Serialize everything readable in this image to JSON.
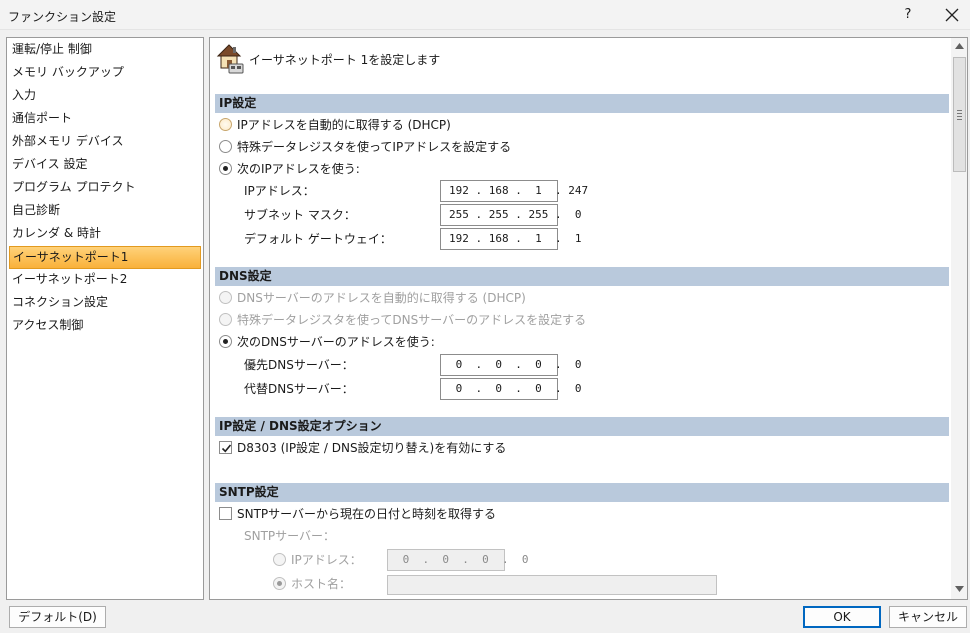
{
  "window": {
    "title": "ファンクション設定",
    "help_label": "?"
  },
  "sidebar": {
    "items": [
      {
        "label": "運転/停止 制御"
      },
      {
        "label": "メモリ バックアップ"
      },
      {
        "label": "入力"
      },
      {
        "label": "通信ポート"
      },
      {
        "label": "外部メモリ デバイス"
      },
      {
        "label": "デバイス 設定"
      },
      {
        "label": "プログラム プロテクト"
      },
      {
        "label": "自己診断"
      },
      {
        "label": "カレンダ & 時計"
      },
      {
        "label": "イーサネットポート1"
      },
      {
        "label": "イーサネットポート2"
      },
      {
        "label": "コネクション設定"
      },
      {
        "label": "アクセス制御"
      }
    ],
    "selected_index": 9
  },
  "main": {
    "header_text": "イーサネットポート 1を設定します",
    "ip_section": {
      "title": "IP設定",
      "radio_auto": "IPアドレスを自動的に取得する (DHCP)",
      "radio_special": "特殊データレジスタを使ってIPアドレスを設定する",
      "radio_manual": "次のIPアドレスを使う:",
      "ip_label": "IPアドレス：",
      "ip_value": "192 . 168 .  1  . 247",
      "mask_label": "サブネット マスク：",
      "mask_value": "255 . 255 . 255 .  0",
      "gateway_label": "デフォルト ゲートウェイ：",
      "gateway_value": "192 . 168 .  1  .  1"
    },
    "dns_section": {
      "title": "DNS設定",
      "radio_auto": "DNSサーバーのアドレスを自動的に取得する (DHCP)",
      "radio_special": "特殊データレジスタを使ってDNSサーバーのアドレスを設定する",
      "radio_manual": "次のDNSサーバーのアドレスを使う:",
      "primary_label": "優先DNSサーバー：",
      "primary_value": " 0  .  0  .  0  .  0",
      "secondary_label": "代替DNSサーバー：",
      "secondary_value": " 0  .  0  .  0  .  0"
    },
    "option_section": {
      "title": "IP設定 / DNS設定オプション",
      "checkbox_label": "D8303 (IP設定 / DNS設定切り替え)を有効にする"
    },
    "sntp_section": {
      "title": "SNTP設定",
      "checkbox_label": "SNTPサーバーから現在の日付と時刻を取得する",
      "server_label": "SNTPサーバー：",
      "radio_ip": "IPアドレス：",
      "ip_value": " 0  .  0  .  0  .  0",
      "radio_host": "ホスト名："
    }
  },
  "footer": {
    "default_button": "デフォルト(D)",
    "ok_button": "OK",
    "cancel_button": "キャンセル"
  }
}
